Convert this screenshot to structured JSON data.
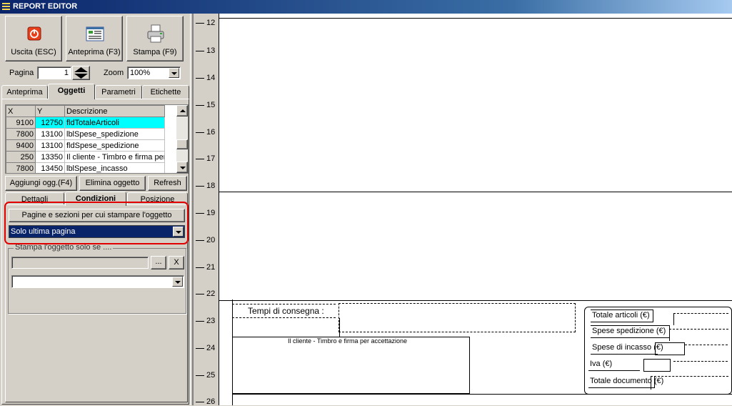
{
  "window": {
    "title": "REPORT EDITOR"
  },
  "toolbar": {
    "exit_label": "Uscita (ESC)",
    "preview_label": "Anteprima (F3)",
    "print_label": "Stampa (F9)"
  },
  "paging": {
    "page_label": "Pagina",
    "page_value": "1",
    "zoom_label": "Zoom",
    "zoom_value": "100%"
  },
  "tabs": [
    "Anteprima",
    "Oggetti",
    "Parametri",
    "Etichette"
  ],
  "objects_grid": {
    "headers": [
      "X",
      "Y",
      "Descrizione"
    ],
    "rows": [
      {
        "x": "9100",
        "y": "12750",
        "desc": "fldTotaleArticoli"
      },
      {
        "x": "7800",
        "y": "13100",
        "desc": "lblSpese_spedizione"
      },
      {
        "x": "9400",
        "y": "13100",
        "desc": "fldSpese_spedizione"
      },
      {
        "x": "250",
        "y": "13350",
        "desc": "Il cliente - Timbro e firma per"
      },
      {
        "x": "7800",
        "y": "13450",
        "desc": "lblSpese_incasso"
      }
    ]
  },
  "object_buttons": {
    "add": "Aggiungi ogg.(F4)",
    "delete": "Elimina oggetto",
    "refresh": "Refresh"
  },
  "subtabs": [
    "Dettagli",
    "Condizioni",
    "Posizione"
  ],
  "conditions": {
    "pages_header": "Pagine e sezioni per cui stampare l'oggetto",
    "pages_value": "Solo ultima pagina",
    "print_if_label": "Stampa l'oggetto solo se ....",
    "browse_label": "...",
    "clear_label": "X"
  },
  "ruler": [
    "12",
    "13",
    "14",
    "15",
    "16",
    "17",
    "18",
    "19",
    "20",
    "21",
    "22",
    "23",
    "24",
    "25",
    "26"
  ],
  "canvas": {
    "delivery_label": "Tempi di consegna :",
    "signature_label": "Il cliente - Timbro e firma per accettazione",
    "totals": {
      "articles": "Totale articoli (€)",
      "shipping": "Spese spedizione (€)",
      "collection": "Spese di incasso (€)",
      "vat": "Iva (€)",
      "document": "Totale documento (€)"
    }
  },
  "colors": {
    "highlight_border": "#e00000",
    "selected_row": "#00ffff",
    "selection": "#0a246a"
  }
}
